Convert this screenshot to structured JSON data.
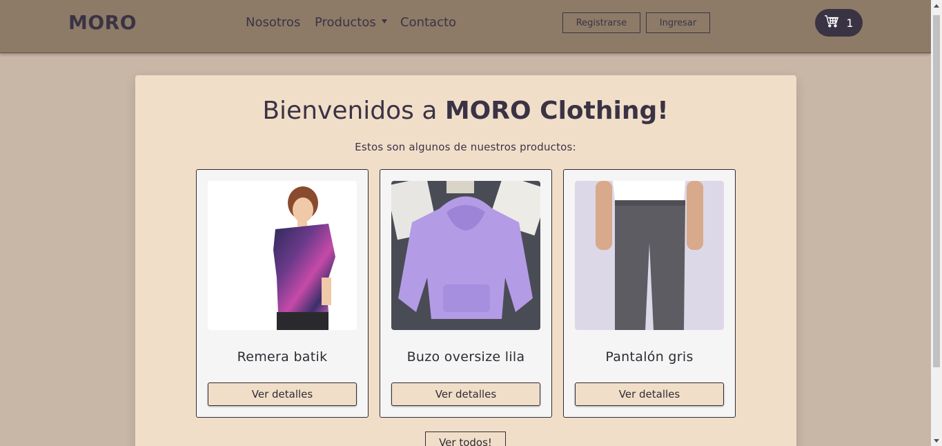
{
  "navbar": {
    "brand": "MORO",
    "links": [
      {
        "label": "Nosotros"
      },
      {
        "label": "Productos"
      },
      {
        "label": "Contacto"
      }
    ],
    "register_label": "Registrarse",
    "login_label": "Ingresar",
    "cart_count": "1",
    "cart_icon": "shopping-cart-icon"
  },
  "hero": {
    "title_prefix": "Bienvenidos a ",
    "title_bold": "MORO Clothing!",
    "subtitle": "Estos son algunos de nuestros productos:"
  },
  "products": [
    {
      "name": "Remera batik",
      "button": "Ver detalles"
    },
    {
      "name": "Buzo oversize lila",
      "button": "Ver detalles"
    },
    {
      "name": "Pantalón gris",
      "button": "Ver detalles"
    }
  ],
  "view_all_label": "Ver todos!",
  "colors": {
    "background": "#c8b6a6",
    "navbar": "#8d7b68",
    "card_bg": "#f1dec9",
    "dark": "#3a3344"
  }
}
